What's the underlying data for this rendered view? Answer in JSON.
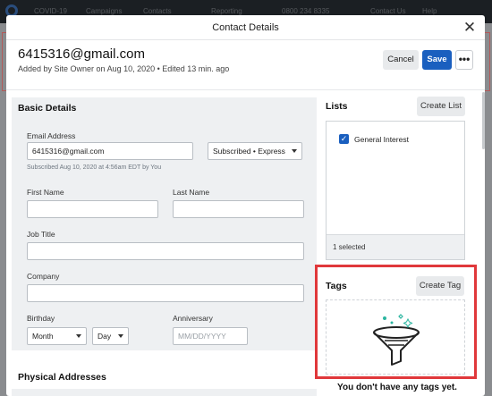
{
  "background_nav": {
    "items": [
      "COVID-19",
      "Campaigns",
      "Contacts",
      "Reporting",
      "0800 234 8335",
      "Contact Us",
      "Help"
    ]
  },
  "modal": {
    "title": "Contact Details",
    "email": "6415316@gmail.com",
    "meta": "Added by Site Owner on Aug 10, 2020 • Edited 13 min. ago",
    "buttons": {
      "cancel": "Cancel",
      "save": "Save",
      "more": "•••"
    }
  },
  "basic_details": {
    "title": "Basic Details",
    "email_label": "Email Address",
    "email_value": "6415316@gmail.com",
    "subscription_status": "Subscribed • Express",
    "subscribed_note": "Subscribed Aug 10, 2020 at 4:56am EDT by You",
    "first_name_label": "First Name",
    "first_name_value": "",
    "last_name_label": "Last Name",
    "last_name_value": "",
    "job_title_label": "Job Title",
    "job_title_value": "",
    "company_label": "Company",
    "company_value": "",
    "birthday_label": "Birthday",
    "birthday_month": "Month",
    "birthday_day": "Day",
    "anniversary_label": "Anniversary",
    "anniversary_placeholder": "MM/DD/YYYY"
  },
  "physical_addresses": {
    "title": "Physical Addresses"
  },
  "lists": {
    "title": "Lists",
    "create_label": "Create List",
    "items": [
      {
        "label": "General Interest",
        "checked": true
      }
    ],
    "footer": "1 selected"
  },
  "tags": {
    "title": "Tags",
    "create_label": "Create Tag",
    "empty_text": "You don't have any tags yet.",
    "icon": "funnel-icon"
  },
  "colors": {
    "primary": "#1a5fbf",
    "highlight": "#e0383b",
    "panel": "#eef0f2"
  }
}
